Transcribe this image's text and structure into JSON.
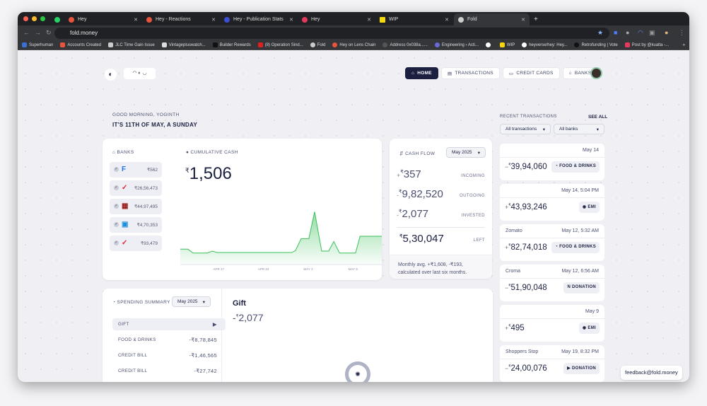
{
  "browser": {
    "tabs": [
      {
        "label": "Hey",
        "color": "#e8553e"
      },
      {
        "label": "Hey - Reactions",
        "color": "#e8553e"
      },
      {
        "label": "Hey - Publication Stats",
        "color": "#3b4fd0"
      },
      {
        "label": "Hey",
        "color": "#e63a5c"
      },
      {
        "label": "WIP",
        "color": "#f5d90a"
      },
      {
        "label": "Fold",
        "color": "#ccc"
      }
    ],
    "url": "fold.money",
    "bookmarks": [
      "Superhuman",
      "Accounts Created",
      "JLC Time Gain Issue",
      "Vintagepluswatch...",
      "Builder Rewards",
      "(8) Operation Sind...",
      "Fold",
      "Hey on Lens Chain",
      "Address 0x038a......",
      "Engineering › Acti...",
      "",
      "WIP",
      "heyverse/hey: Hey...",
      "Retrofunding | Vote",
      "Post by @kualta -..."
    ]
  },
  "nav": {
    "home": "HOME",
    "transactions": "TRANSACTIONS",
    "credit_cards": "CREDIT CARDS",
    "banks": "BANKS"
  },
  "greeting": {
    "line1": "GOOD MORNING, YOGINTH",
    "line2": "IT'S 11TH OF MAY, A SUNDAY"
  },
  "banks": {
    "title": "BANKS",
    "items": [
      {
        "amount": "₹562",
        "logo": "F",
        "color": "#1e73e8"
      },
      {
        "amount": "₹26,56,473",
        "logo": "✓",
        "color": "#e0233a"
      },
      {
        "amount": "₹44,97,495",
        "logo": "▦",
        "color": "#9b1c1c"
      },
      {
        "amount": "₹4,70,353",
        "logo": "▣",
        "color": "#1c8fe0"
      },
      {
        "amount": "₹93,479",
        "logo": "✓",
        "color": "#e0233a"
      }
    ]
  },
  "cumulative": {
    "title": "CUMULATIVE CASH",
    "currency": "₹",
    "value": "1,506"
  },
  "chart_data": {
    "type": "area",
    "title": "CUMULATIVE CASH",
    "x_unit": "days since Apr 11",
    "x": [
      0,
      1.2,
      2,
      4.2,
      5,
      5.8,
      17.4,
      18,
      18.9,
      20.1,
      21,
      22.1,
      23.2,
      24,
      24.9,
      27.4,
      28.1,
      31.5
    ],
    "values": [
      64,
      64,
      48,
      48,
      56,
      50,
      50,
      58,
      108,
      108,
      220,
      56,
      56,
      96,
      48,
      48,
      118,
      118
    ],
    "ticks": [
      {
        "x": 6,
        "label": "APR 17"
      },
      {
        "x": 13,
        "label": "APR 24"
      },
      {
        "x": 20,
        "label": "MAY 1"
      },
      {
        "x": 27,
        "label": "MAY 8"
      }
    ],
    "xlim": [
      0,
      31.5
    ],
    "ylim": [
      0,
      230
    ],
    "color": "#3cc05a",
    "grid": false
  },
  "cashflow": {
    "title": "CASH FLOW",
    "period": "May 2025",
    "rows": [
      {
        "sign": "+",
        "value": "357",
        "label": "INCOMING"
      },
      {
        "sign": "-",
        "value": "9,82,520",
        "label": "OUTGOING"
      },
      {
        "sign": "-",
        "value": "2,077",
        "label": "INVESTED"
      }
    ],
    "left": {
      "value": "5,30,047",
      "label": "LEFT"
    },
    "note": "Monthly avg. +₹1,608, -₹193, calculated over last six months."
  },
  "recent": {
    "title": "RECENT TRANSACTIONS",
    "see_all": "SEE ALL",
    "filter_type": "All transactions",
    "filter_bank": "All banks",
    "items": [
      {
        "name": "",
        "date": "May 14",
        "sign": "−",
        "amount": "39,94,060",
        "tag": "FOOD & DRINKS",
        "icon": "food-icon"
      },
      {
        "name": "",
        "date": "May 14, 5:04 PM",
        "sign": "+",
        "amount": "43,93,246",
        "tag": "EMI",
        "icon": "emi-icon"
      },
      {
        "name": "Zomato",
        "date": "May 12, 5:32 AM",
        "sign": "+",
        "amount": "82,74,018",
        "tag": "FOOD & DRINKS",
        "icon": "food-icon"
      },
      {
        "name": "Croma",
        "date": "May 12, 6:56 AM",
        "sign": "−",
        "amount": "51,90,048",
        "tag": "DONATION",
        "icon": "donation-icon"
      },
      {
        "name": "",
        "date": "May 9",
        "sign": "+",
        "amount": "495",
        "tag": "EMI",
        "icon": "emi-icon"
      },
      {
        "name": "Shoppers Stop",
        "date": "May 19, 8:32 PM",
        "sign": "−",
        "amount": "24,00,076",
        "tag": "DONATION",
        "icon": "video-icon"
      }
    ]
  },
  "spending": {
    "title": "SPENDING SUMMARY",
    "period": "May 2025",
    "items": [
      {
        "name": "GIFT",
        "amount": "▶"
      },
      {
        "name": "FOOD & DRINKS",
        "amount": "-₹8,78,845"
      },
      {
        "name": "CREDIT BILL",
        "amount": "-₹1,46,565"
      },
      {
        "name": "CREDIT BILL",
        "amount": "-₹27,742"
      }
    ],
    "detail_title": "Gift",
    "detail_sign": "-",
    "detail_value": "2,077"
  },
  "feedback": "feedback@fold.money"
}
